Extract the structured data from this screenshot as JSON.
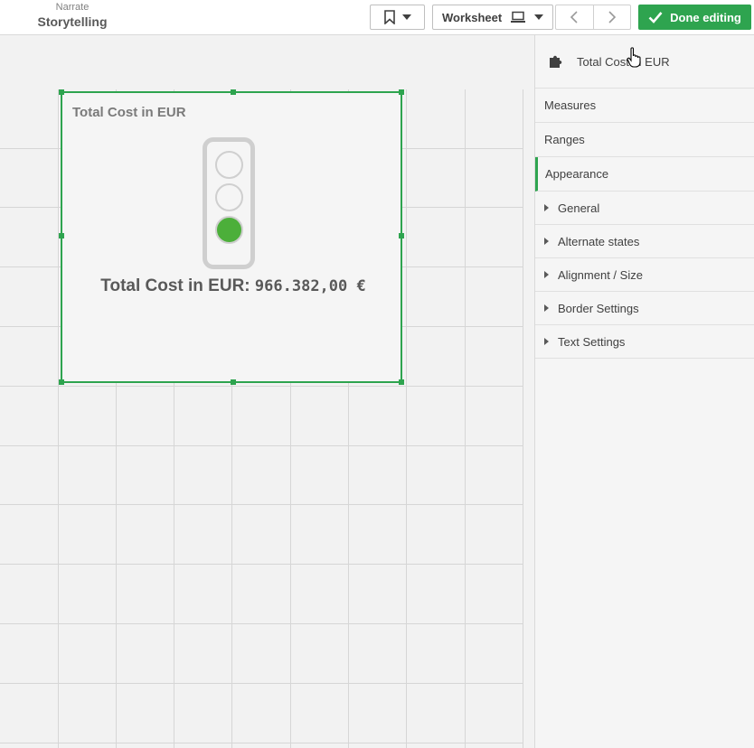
{
  "topbar": {
    "sheet_kind": "Narrate",
    "sheet_name": "Storytelling",
    "worksheet_label": "Worksheet",
    "done_label": "Done editing"
  },
  "object": {
    "title": "Total Cost in EUR",
    "kpi_label": "Total Cost in EUR:",
    "kpi_value": "966.382,00 €",
    "active_light": "green"
  },
  "panel": {
    "header": "Total Cost in EUR",
    "sections": [
      "Measures",
      "Ranges",
      "Appearance"
    ],
    "active_section": "Appearance",
    "subsections": [
      "General",
      "Alternate states",
      "Alignment / Size",
      "Border Settings",
      "Text Settings"
    ]
  },
  "colors": {
    "accent": "#2ea44f",
    "light_on": "#4caf3a"
  }
}
